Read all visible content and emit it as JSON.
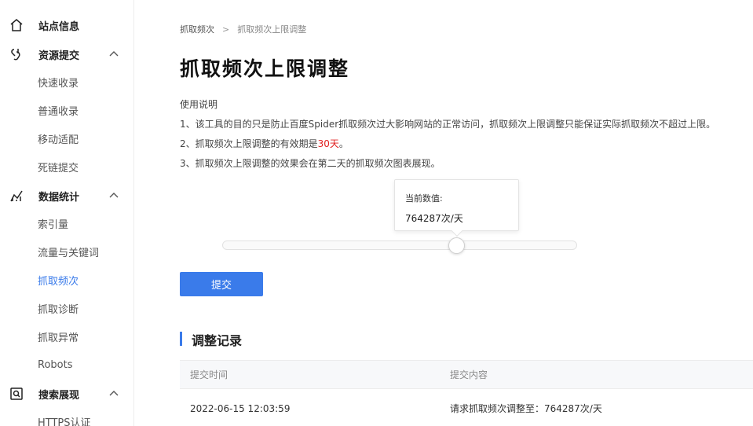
{
  "sidebar": {
    "groups": [
      {
        "label": "站点信息",
        "icon": "home-icon"
      },
      {
        "label": "资源提交",
        "icon": "link-icon",
        "expanded": true,
        "items": [
          "快速收录",
          "普通收录",
          "移动适配",
          "死链提交"
        ]
      },
      {
        "label": "数据统计",
        "icon": "chart-icon",
        "expanded": true,
        "items": [
          "索引量",
          "流量与关键词",
          "抓取频次",
          "抓取诊断",
          "抓取异常",
          "Robots"
        ]
      },
      {
        "label": "搜索展现",
        "icon": "search-box-icon",
        "expanded": true,
        "items": [
          "HTTPS认证"
        ]
      }
    ],
    "active_item": "抓取频次"
  },
  "breadcrumb": {
    "parent": "抓取频次",
    "separator": ">",
    "current": "抓取频次上限调整"
  },
  "page": {
    "title": "抓取频次上限调整",
    "usage_heading": "使用说明",
    "usage_1": "1、该工具的目的只是防止百度Spider抓取频次过大影响网站的正常访问，抓取频次上限调整只能保证实际抓取频次不超过上限。",
    "usage_2_prefix": "2、抓取频次上限调整的有效期是",
    "usage_2_highlight": "30天",
    "usage_2_suffix": "。",
    "usage_3": "3、抓取频次上限调整的效果会在第二天的抓取频次图表展现。"
  },
  "slider": {
    "tooltip_label": "当前数值:",
    "tooltip_value": "764287次/天"
  },
  "submit_label": "提交",
  "records": {
    "title": "调整记录",
    "columns": [
      "提交时间",
      "提交内容"
    ],
    "rows": [
      [
        "2022-06-15 12:03:59",
        "请求抓取频次调整至：764287次/天"
      ]
    ]
  },
  "colors": {
    "accent": "#3a7bea",
    "highlight": "#e02020"
  }
}
